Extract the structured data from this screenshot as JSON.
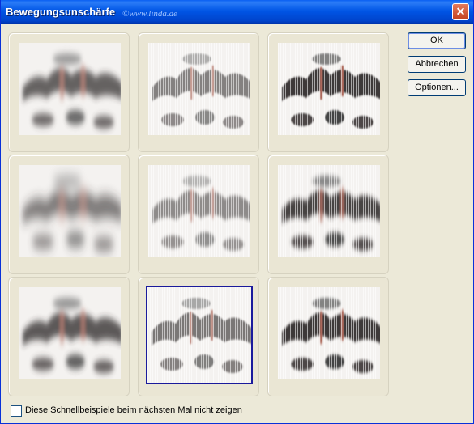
{
  "dialog": {
    "title": "Bewegungsunschärfe",
    "watermark": "©www.linda.de",
    "close_glyph": "✕"
  },
  "buttons": {
    "ok": "OK",
    "cancel": "Abbrechen",
    "options": "Optionen..."
  },
  "checkbox": {
    "label": "Diese Schnellbeispiele beim nächsten Mal nicht zeigen",
    "checked": false
  },
  "previews": {
    "count": 9,
    "selected_index": 4,
    "icons": [
      "blur-preview-thumbnail"
    ]
  },
  "colors": {
    "title_bar": "#0054E3",
    "selected_border": "#1A1A9C",
    "dialog_bg": "#ECE9D8"
  }
}
